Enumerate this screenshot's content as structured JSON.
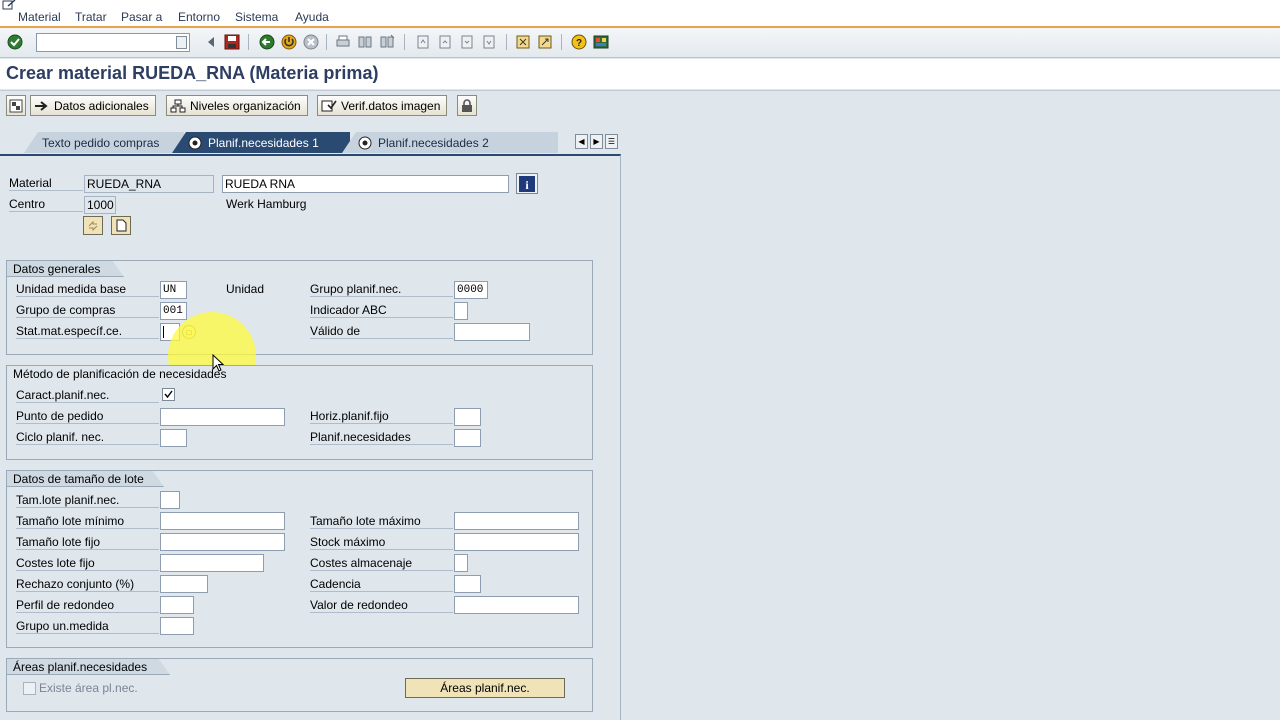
{
  "menu": {
    "items": [
      "Material",
      "Tratar",
      "Pasar a",
      "Entorno",
      "Sistema",
      "Ayuda"
    ]
  },
  "toolbar": {
    "command_value": "",
    "icons": [
      "enter-icon",
      "back-icon",
      "exit-icon",
      "cancel-icon",
      "print-icon",
      "find-icon",
      "find-next-icon",
      "first-page-icon",
      "previous-page-icon",
      "next-page-icon",
      "last-page-icon",
      "new-session-icon",
      "shortcut-icon",
      "help-icon",
      "layout-icon"
    ]
  },
  "title": "Crear material RUEDA_RNA (Materia prima)",
  "app_toolbar": {
    "buttons": [
      "Datos adicionales",
      "Niveles organización",
      "Verif.datos imagen"
    ]
  },
  "tabs": [
    {
      "label": "Texto pedido compras",
      "active": false
    },
    {
      "label": "Planif.necesidades 1",
      "active": true
    },
    {
      "label": "Planif.necesidades 2",
      "active": false
    }
  ],
  "header": {
    "material_label": "Material",
    "material_value": "RUEDA_RNA",
    "material_desc": "RUEDA RNA",
    "centro_label": "Centro",
    "centro_value": "1000",
    "centro_desc": "Werk Hamburg"
  },
  "datos_generales": {
    "title": "Datos generales",
    "umb_label": "Unidad medida base",
    "umb_value": "UN",
    "umb_desc": "Unidad",
    "grupo_planif_label": "Grupo planif.nec.",
    "grupo_planif_value": "0000",
    "grupo_compras_label": "Grupo de compras",
    "grupo_compras_value": "001",
    "indicador_abc_label": "Indicador ABC",
    "indicador_abc_value": "",
    "stat_label": "Stat.mat.específ.ce.",
    "stat_value": "",
    "valido_label": "Válido de",
    "valido_value": ""
  },
  "metodo": {
    "title": "Método de planificación de necesidades",
    "caract_label": "Caract.planif.nec.",
    "caract_checked": true,
    "punto_label": "Punto de pedido",
    "punto_value": "",
    "horiz_label": "Horiz.planif.fijo",
    "horiz_value": "",
    "ciclo_label": "Ciclo planif. nec.",
    "ciclo_value": "",
    "planif_label": "Planif.necesidades",
    "planif_value": ""
  },
  "lote": {
    "title": "Datos de tamaño de lote",
    "tam_lote_label": "Tam.lote planif.nec.",
    "tam_min_label": "Tamaño lote mínimo",
    "tam_max_label": "Tamaño lote máximo",
    "tam_fijo_label": "Tamaño lote fijo",
    "stock_max_label": "Stock máximo",
    "costes_fijo_label": "Costes lote fijo",
    "costes_alm_label": "Costes almacenaje",
    "rechazo_label": "Rechazo conjunto (%)",
    "cadencia_label": "Cadencia",
    "perfil_label": "Perfil de redondeo",
    "valor_label": "Valor de redondeo",
    "grupo_um_label": "Grupo un.medida"
  },
  "areas": {
    "title": "Áreas planif.necesidades",
    "existe_label": "Existe área pl.nec.",
    "button_label": "Áreas planif.nec."
  }
}
